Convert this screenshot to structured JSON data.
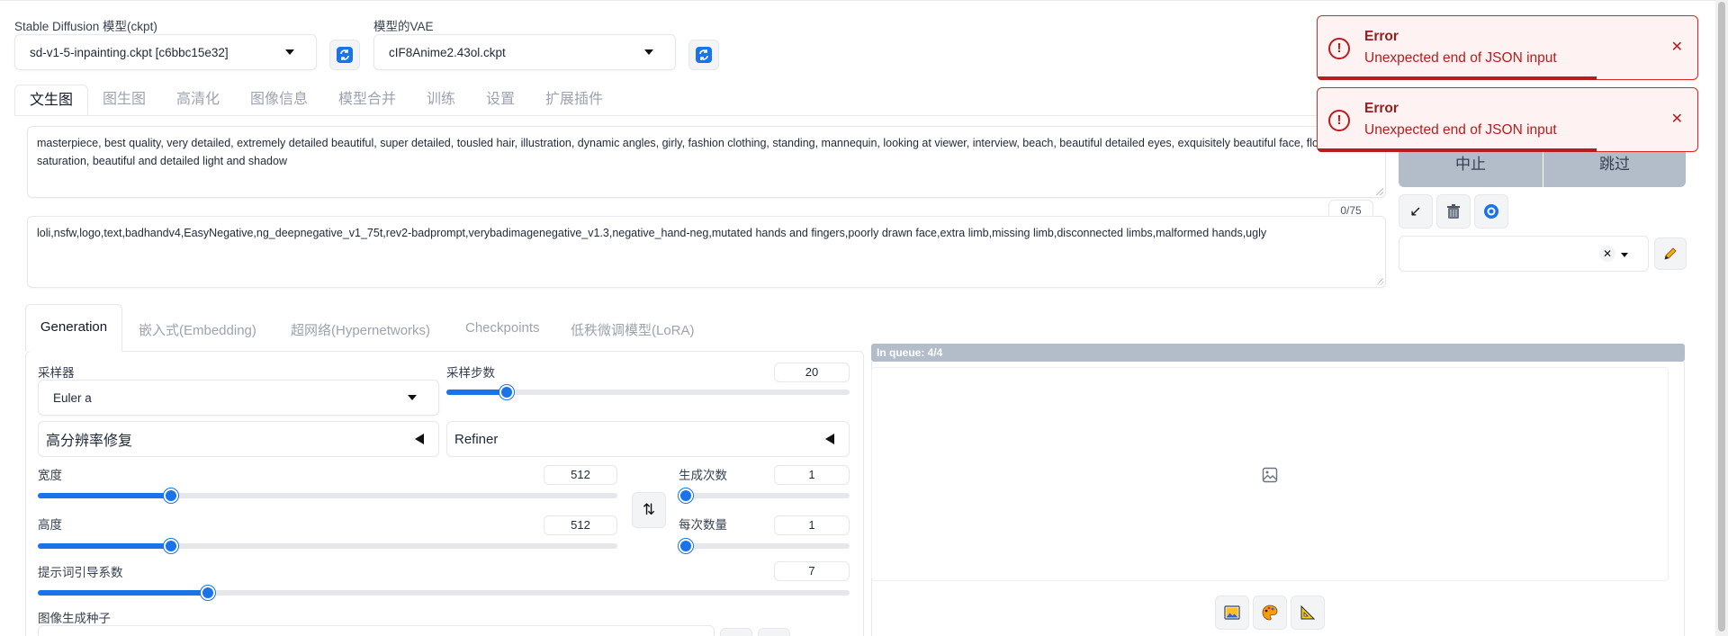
{
  "model": {
    "label": "Stable Diffusion 模型(ckpt)",
    "value": "sd-v1-5-inpainting.ckpt [c6bbc15e32]"
  },
  "vae": {
    "label": "模型的VAE",
    "value": "cIF8Anime2.43ol.ckpt"
  },
  "main_tabs": [
    "文生图",
    "图生图",
    "高清化",
    "图像信息",
    "模型合并",
    "训练",
    "设置",
    "扩展插件"
  ],
  "prompt": {
    "positive": "masterpiece, best quality, very detailed, extremely detailed beautiful, super detailed, tousled hair, illustration, dynamic angles, girly, fashion clothing, standing, mannequin, looking at viewer, interview, beach, beautiful detailed eyes, exquisitely beautiful face, floating, high saturation, beautiful and detailed light and shadow",
    "negative": "loli,nsfw,logo,text,badhandv4,EasyNegative,ng_deepnegative_v1_75t,rev2-badprompt,verybadimagenegative_v1.3,negative_hand-neg,mutated hands and fingers,poorly drawn face,extra limb,missing limb,disconnected limbs,malformed hands,ugly",
    "token_count": "0/75"
  },
  "actions": {
    "interrupt": "中止",
    "skip": "跳过"
  },
  "sub_tabs": [
    "Generation",
    "嵌入式(Embedding)",
    "超网络(Hypernetworks)",
    "Checkpoints",
    "低秩微调模型(LoRA)"
  ],
  "sampler": {
    "label": "采样器",
    "value": "Euler a"
  },
  "steps": {
    "label": "采样步数",
    "value": "20",
    "fraction": 0.15
  },
  "hires": {
    "label": "高分辨率修复"
  },
  "refiner": {
    "label": "Refiner"
  },
  "width": {
    "label": "宽度",
    "value": "512",
    "fraction": 0.23
  },
  "height": {
    "label": "高度",
    "value": "512",
    "fraction": 0.23
  },
  "batch_count": {
    "label": "生成次数",
    "value": "1",
    "fraction": 0.0
  },
  "batch_size": {
    "label": "每次数量",
    "value": "1",
    "fraction": 0.0
  },
  "cfg": {
    "label": "提示词引导系数",
    "value": "7",
    "fraction": 0.21
  },
  "seed": {
    "label": "图像生成种子"
  },
  "queue": {
    "text": "In queue: 4/4"
  },
  "toasts": [
    {
      "title": "Error",
      "message": "Unexpected end of JSON input"
    },
    {
      "title": "Error",
      "message": "Unexpected end of JSON input"
    }
  ],
  "icons": {
    "refresh": "refresh-icon",
    "trash": "trash-icon",
    "image": "image-icon",
    "palette": "palette-icon",
    "ruler": "ruler-icon"
  },
  "colors": {
    "accent": "#1a73e8",
    "error": "#dc2626",
    "queue_bar": "#b3bcc9"
  }
}
